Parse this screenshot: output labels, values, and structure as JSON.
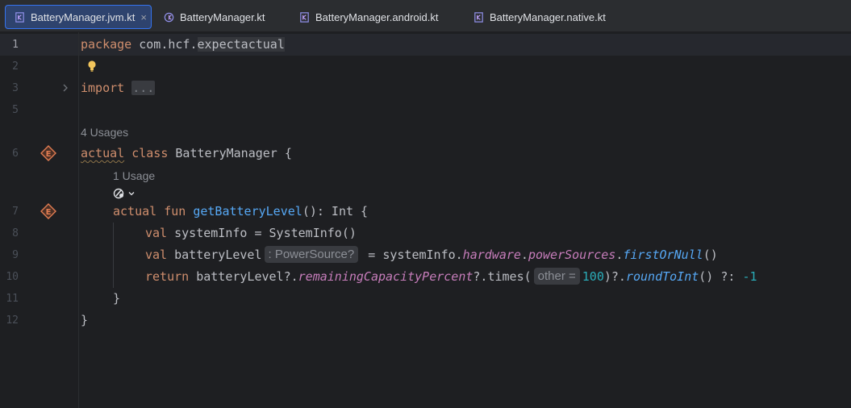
{
  "tabs": [
    {
      "label": "BatteryManager.jvm.kt",
      "active": true,
      "closable": true,
      "icon": "kotlin-file-icon"
    },
    {
      "label": "BatteryManager.kt",
      "active": false,
      "icon": "kotlin-multiplatform-file-icon"
    },
    {
      "label": "BatteryManager.android.kt",
      "active": false,
      "icon": "kotlin-file-icon"
    },
    {
      "label": "BatteryManager.native.kt",
      "active": false,
      "icon": "kotlin-file-icon"
    }
  ],
  "tab_close_glyph": "×",
  "line_numbers": [
    "1",
    "2",
    "3",
    "5",
    "6",
    "7",
    "8",
    "9",
    "10",
    "11",
    "12"
  ],
  "code": {
    "l1_kw": "package",
    "l1_pkg": " com.hcf.",
    "l1_pkg_hl": "expectactual",
    "l3_kw": "import",
    "l3_fold": "...",
    "usages_class": "4 Usages",
    "l6_kw1": "actual",
    "l6_kw2": " class",
    "l6_rest": " BatteryManager {",
    "usages_fun": "1 Usage",
    "l7_kw1": "actual",
    "l7_kw2": " fun",
    "l7_fn": " getBatteryLevel",
    "l7_rest": "(): Int {",
    "l8_kw": "val",
    "l8_rest": " systemInfo = SystemInfo()",
    "l9_kw": "val",
    "l9_name": " batteryLevel",
    "l9_hint": ": PowerSource?",
    "l9_eq": " = systemInfo.",
    "l9_p1": "hardware",
    "l9_dot1": ".",
    "l9_p2": "powerSources",
    "l9_dot2": ".",
    "l9_ext": "firstOrNull",
    "l9_end": "()",
    "l10_kw": "return",
    "l10_a": " batteryLevel?.",
    "l10_prop": "remainingCapacityPercent",
    "l10_b": "?.times(",
    "l10_hint": "other =",
    "l10_num": "100",
    "l10_c": ")?.",
    "l10_ext": "roundToInt",
    "l10_d": "() ?: ",
    "l10_neg": "-1",
    "l11": "}",
    "l12": "}"
  },
  "colors": {
    "background": "#1e1f22",
    "keyword": "#cf8e6d",
    "function": "#56a8f5",
    "property": "#c77dbb",
    "number": "#2aacb8",
    "text": "#bcbec4",
    "active_tab": "#2e436e",
    "gutter_icon": "#e27d52"
  },
  "icons": {
    "intention": "lightbulb-icon",
    "fold": "chevron-right-icon",
    "expect_actual_marker": "expect-actual-gutter-icon",
    "interface_marker": "interface-marker-icon",
    "dropdown": "chevron-down-icon"
  }
}
